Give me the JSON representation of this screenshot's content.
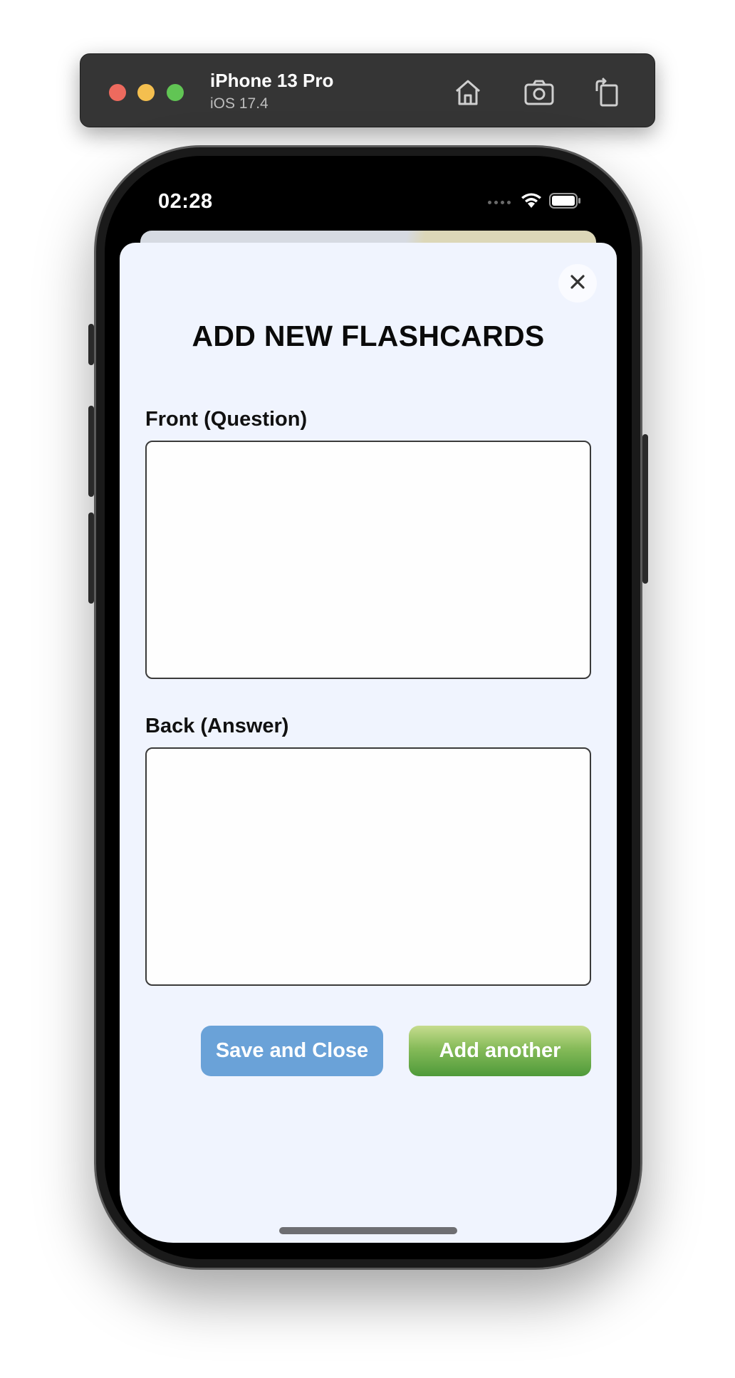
{
  "simulator": {
    "device_name": "iPhone 13 Pro",
    "os_version": "iOS 17.4",
    "toolbar_icons": [
      "home-icon",
      "screenshot-icon",
      "rotate-icon"
    ]
  },
  "status_bar": {
    "time": "02:28",
    "icons": [
      "signal-icon",
      "wifi-icon",
      "battery-icon"
    ]
  },
  "modal": {
    "title": "ADD NEW FLASHCARDS",
    "close_icon": "close-icon",
    "front": {
      "label": "Front (Question)",
      "value": "",
      "placeholder": ""
    },
    "back": {
      "label": "Back (Answer)",
      "value": "",
      "placeholder": ""
    },
    "buttons": {
      "save_close": "Save and Close",
      "add_another": "Add another"
    }
  },
  "colors": {
    "modal_background": "#f0f4fe",
    "save_button": "#6aa2d8",
    "add_button": "#5ea245"
  }
}
